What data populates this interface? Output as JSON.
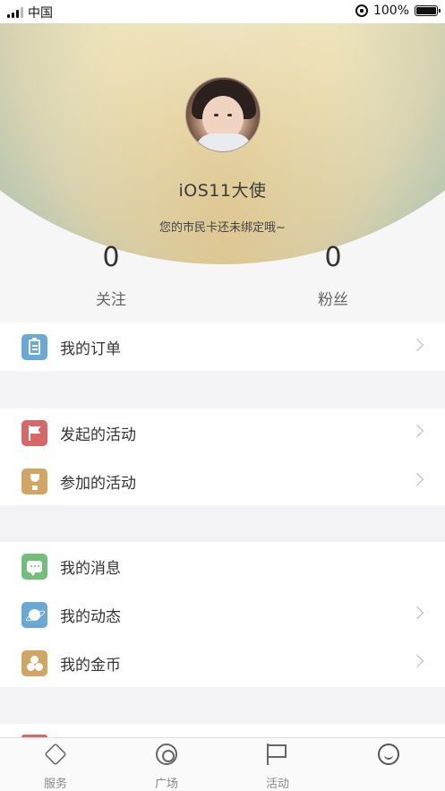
{
  "status_bar": {
    "carrier": "中国",
    "battery": "100%",
    "battery_level": 1.0
  },
  "profile": {
    "avatar": "avatar-photo",
    "username": "iOS11大使",
    "card_hint": "您的市民卡还未绑定哦~",
    "stats": [
      {
        "value": "0",
        "label": "关注"
      },
      {
        "value": "0",
        "label": "粉丝"
      }
    ]
  },
  "menu": {
    "groups": [
      {
        "items": [
          {
            "label": "我的订单",
            "icon": "clipboard-icon",
            "color": "#6aa9d6",
            "chevron": true
          }
        ]
      },
      {
        "items": [
          {
            "label": "发起的活动",
            "icon": "flag-icon",
            "color": "#d8676a",
            "chevron": true
          },
          {
            "label": "参加的活动",
            "icon": "trophy-icon",
            "color": "#d1a564",
            "chevron": true
          }
        ]
      },
      {
        "items": [
          {
            "label": "我的消息",
            "icon": "message-icon",
            "color": "#74be7b",
            "chevron": false
          },
          {
            "label": "我的动态",
            "icon": "planet-icon",
            "color": "#6aa9d6",
            "chevron": true
          },
          {
            "label": "我的金币",
            "icon": "coins-icon",
            "color": "#d1a564",
            "chevron": true
          }
        ]
      }
    ]
  },
  "tab_bar": {
    "tabs": [
      {
        "label": "服务",
        "icon": "service-icon"
      },
      {
        "label": "广场",
        "icon": "compass-icon"
      },
      {
        "label": "活动",
        "icon": "flag-icon"
      },
      {
        "label": "",
        "icon": "smiley-icon"
      }
    ]
  }
}
